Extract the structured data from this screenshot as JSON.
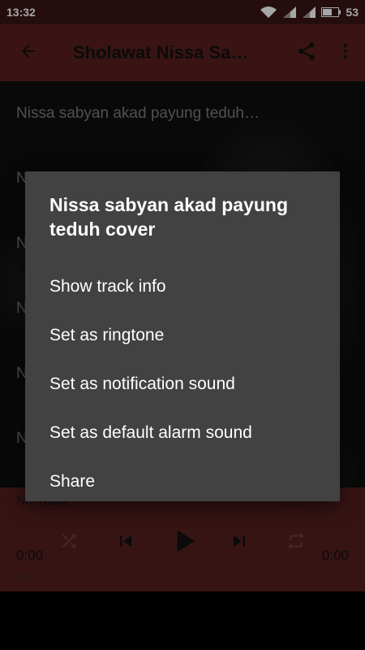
{
  "status_bar": {
    "time": "13:32",
    "battery": "53",
    "icons": [
      "wifi-icon",
      "signal-icon",
      "signal-icon",
      "battery-icon"
    ]
  },
  "app_bar": {
    "title": "Sholawat Nissa Sa…",
    "back_icon": "arrow-back-icon",
    "share_icon": "share-icon",
    "menu_icon": "more-vert-icon"
  },
  "list": {
    "items": [
      "Nissa sabyan akad payung teduh…",
      "N",
      "N",
      "N",
      "N",
      "N"
    ]
  },
  "player": {
    "track": "No Track",
    "time_elapsed": "0:00",
    "time_total": "0:00",
    "controls": [
      "shuffle-icon",
      "skip-previous-icon",
      "play-icon",
      "skip-next-icon",
      "repeat-icon"
    ]
  },
  "dialog": {
    "title": "Nissa sabyan akad payung teduh cover",
    "items": [
      "Show track info",
      "Set as ringtone",
      "Set as notification sound",
      "Set as default alarm sound",
      "Share"
    ]
  },
  "colors": {
    "accent": "#5a1f1f",
    "status_bar": "#3a1414",
    "dialog_bg": "#424242"
  }
}
